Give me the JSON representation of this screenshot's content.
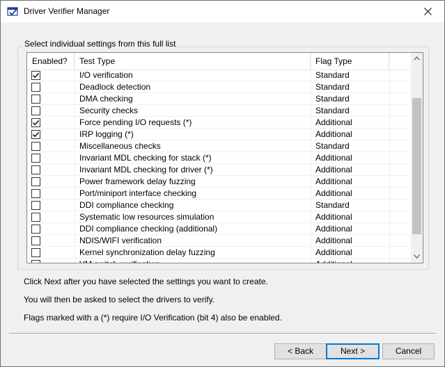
{
  "window": {
    "title": "Driver Verifier Manager"
  },
  "icons": {
    "app": "driver-verifier-app-icon",
    "close": "close-icon",
    "check": "checkmark-icon",
    "scroll_up": "chevron-up-icon",
    "scroll_down": "chevron-down-icon"
  },
  "group": {
    "label": "Select individual settings from this full list"
  },
  "list": {
    "headers": {
      "enabled": "Enabled?",
      "test_type": "Test Type",
      "flag_type": "Flag Type"
    },
    "rows": [
      {
        "checked": true,
        "test": "I/O verification",
        "flag": "Standard"
      },
      {
        "checked": false,
        "test": "Deadlock detection",
        "flag": "Standard"
      },
      {
        "checked": false,
        "test": "DMA checking",
        "flag": "Standard"
      },
      {
        "checked": false,
        "test": "Security checks",
        "flag": "Standard"
      },
      {
        "checked": true,
        "test": "Force pending I/O requests (*)",
        "flag": "Additional"
      },
      {
        "checked": true,
        "test": "IRP logging (*)",
        "flag": "Additional"
      },
      {
        "checked": false,
        "test": "Miscellaneous checks",
        "flag": "Standard"
      },
      {
        "checked": false,
        "test": "Invariant MDL checking for stack (*)",
        "flag": "Additional"
      },
      {
        "checked": false,
        "test": "Invariant MDL checking for driver (*)",
        "flag": "Additional"
      },
      {
        "checked": false,
        "test": "Power framework delay fuzzing",
        "flag": "Additional"
      },
      {
        "checked": false,
        "test": "Port/miniport interface checking",
        "flag": "Additional"
      },
      {
        "checked": false,
        "test": "DDI compliance checking",
        "flag": "Standard"
      },
      {
        "checked": false,
        "test": "Systematic low resources simulation",
        "flag": "Additional"
      },
      {
        "checked": false,
        "test": "DDI compliance checking (additional)",
        "flag": "Additional"
      },
      {
        "checked": false,
        "test": "NDIS/WIFI verification",
        "flag": "Additional"
      },
      {
        "checked": false,
        "test": "Kernel synchronization delay fuzzing",
        "flag": "Additional"
      },
      {
        "checked": false,
        "test": "VM switch verification",
        "flag": "Additional"
      }
    ]
  },
  "info": {
    "line1": "Click Next after you have selected the settings you want to create.",
    "line2": "You will then be asked to select the drivers to verify.",
    "line3": "Flags marked with a (*) require I/O Verification (bit 4) also be enabled."
  },
  "buttons": {
    "back": "< Back",
    "next": "Next >",
    "cancel": "Cancel"
  },
  "colors": {
    "window_bg": "#f0f0f0",
    "accent": "#0078d7",
    "button_bg": "#e1e1e1"
  }
}
